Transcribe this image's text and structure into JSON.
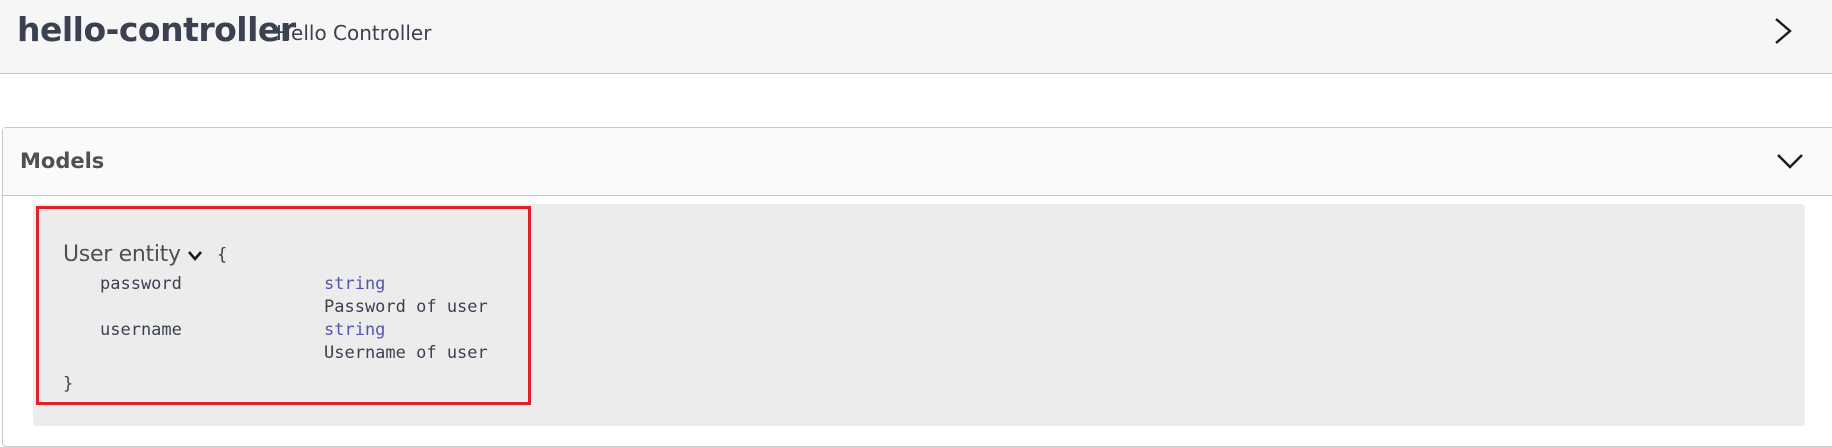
{
  "tag": {
    "name": "hello-controller",
    "description": "Hello Controller",
    "expand_icon": "chevron-right-icon"
  },
  "models": {
    "title": "Models",
    "toggle_icon": "chevron-down-icon",
    "items": [
      {
        "name": "User entity",
        "toggle_icon": "chevron-down-icon",
        "open_brace": "{",
        "close_brace": "}",
        "properties": [
          {
            "name": "password",
            "type": "string",
            "description": "Password of user"
          },
          {
            "name": "username",
            "type": "string",
            "description": "Username of user"
          }
        ]
      }
    ]
  },
  "colors": {
    "highlight_border": "#e0202a",
    "type_color": "#5555aa",
    "header_bg": "#f6f6f6",
    "model_bg": "#ececec"
  }
}
